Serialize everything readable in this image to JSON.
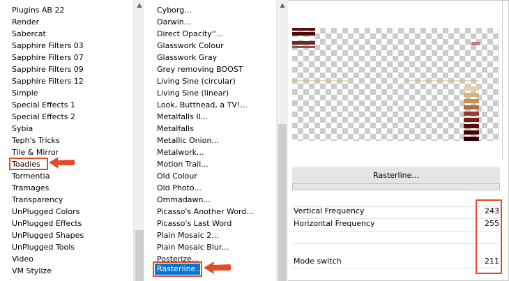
{
  "filter_categories": [
    "Plugins AB 22",
    "Render",
    "Sabercat",
    "Sapphire Filters 03",
    "Sapphire Filters 07",
    "Sapphire Filters 09",
    "Sapphire Filters 12",
    "Simple",
    "Special Effects 1",
    "Special Effects 2",
    "Sybia",
    "Teph's Tricks",
    "Tile & Mirror",
    "Toadies",
    "Tormentia",
    "Tramages",
    "Transparency",
    "UnPlugged Colors",
    "UnPlugged Effects",
    "UnPlugged Shapes",
    "UnPlugged Tools",
    "Video",
    "VM Stylize"
  ],
  "highlighted_category": "Toadies",
  "filters": [
    "Cyborg...",
    "Darwin...",
    "Direct Opacity''...",
    "Glasswork Colour",
    "Glasswork Gray",
    "Grey removing BOOST",
    "Living Sine (circular)",
    "Living Sine (linear)",
    "Look, Butthead, a TV!...",
    "Metalfalls II...",
    "Metalfalls",
    "Metallic Onion...",
    "Metalwork...",
    "Motion Trail...",
    "Old Colour",
    "Old Photo...",
    "Ommadawn...",
    "Picasso's Another Word...",
    "Picasso's Last Word",
    "Plain Mosaic 2...",
    "Plain Mosaic Blur...",
    "Posterize...",
    "Rasterline..."
  ],
  "selected_filter": "Rasterline...",
  "filter_button_label": "Rasterline...",
  "params": [
    {
      "label": "Vertical Frequency",
      "value": "243"
    },
    {
      "label": "Horizontal Frequency",
      "value": "255"
    },
    {
      "label": "Mode switch",
      "value": "211"
    }
  ],
  "colors": {
    "highlight_box": "#e24b26",
    "selection": "#0078d7"
  },
  "icons": {
    "scroll_up": "▲",
    "scroll_down": "▼"
  }
}
